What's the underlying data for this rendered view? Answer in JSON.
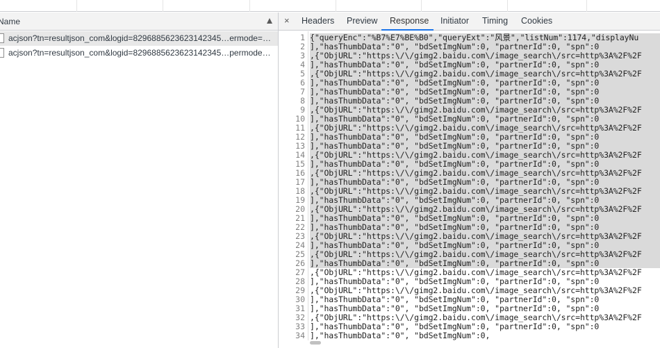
{
  "left": {
    "column_header": "Name",
    "requests": [
      "acjson?tn=resultjson_com&logid=8296885623623142345…ermode=…",
      "acjson?tn=resultjson_com&logid=8296885623623142345…permode…"
    ]
  },
  "tabs": {
    "close_symbol": "×",
    "items": [
      "Headers",
      "Preview",
      "Response",
      "Initiator",
      "Timing",
      "Cookies"
    ],
    "active": "Response"
  },
  "response": {
    "lines": [
      "{\"queryEnc\":\"%B7%E7%BE%B0\",\"queryExt\":\"风景\",\"listNum\":1174,\"displayNu",
      "],\"hasThumbData\":\"0\",    \"bdSetImgNum\":0,    \"partnerId\":0,    \"spn\":0",
      ",{\"ObjURL\":\"https:\\/\\/gimg2.baidu.com\\/image_search\\/src=http%3A%2F%2F",
      "],\"hasThumbData\":\"0\",    \"bdSetImgNum\":0,    \"partnerId\":0,    \"spn\":0",
      ",{\"ObjURL\":\"https:\\/\\/gimg2.baidu.com\\/image_search\\/src=http%3A%2F%2F",
      "],\"hasThumbData\":\"0\",    \"bdSetImgNum\":0,    \"partnerId\":0,    \"spn\":0",
      "],\"hasThumbData\":\"0\",    \"bdSetImgNum\":0,    \"partnerId\":0,    \"spn\":0",
      "],\"hasThumbData\":\"0\",    \"bdSetImgNum\":0,    \"partnerId\":0,    \"spn\":0",
      ",{\"ObjURL\":\"https:\\/\\/gimg2.baidu.com\\/image_search\\/src=http%3A%2F%2F",
      "],\"hasThumbData\":\"0\",    \"bdSetImgNum\":0,    \"partnerId\":0,    \"spn\":0",
      ",{\"ObjURL\":\"https:\\/\\/gimg2.baidu.com\\/image_search\\/src=http%3A%2F%2F",
      "],\"hasThumbData\":\"0\",    \"bdSetImgNum\":0,    \"partnerId\":0,    \"spn\":0",
      "],\"hasThumbData\":\"0\",    \"bdSetImgNum\":0,    \"partnerId\":0,    \"spn\":0",
      ",{\"ObjURL\":\"https:\\/\\/gimg2.baidu.com\\/image_search\\/src=http%3A%2F%2F",
      "],\"hasThumbData\":\"0\",    \"bdSetImgNum\":0,    \"partnerId\":0,    \"spn\":0",
      ",{\"ObjURL\":\"https:\\/\\/gimg2.baidu.com\\/image_search\\/src=http%3A%2F%2F",
      "],\"hasThumbData\":\"0\",    \"bdSetImgNum\":0,    \"partnerId\":0,    \"spn\":0",
      ",{\"ObjURL\":\"https:\\/\\/gimg2.baidu.com\\/image_search\\/src=http%3A%2F%2F",
      "],\"hasThumbData\":\"0\",    \"bdSetImgNum\":0,    \"partnerId\":0,    \"spn\":0",
      ",{\"ObjURL\":\"https:\\/\\/gimg2.baidu.com\\/image_search\\/src=http%3A%2F%2F",
      "],\"hasThumbData\":\"0\",    \"bdSetImgNum\":0,    \"partnerId\":0,    \"spn\":0",
      "],\"hasThumbData\":\"0\",    \"bdSetImgNum\":0,    \"partnerId\":0,    \"spn\":0",
      ",{\"ObjURL\":\"https:\\/\\/gimg2.baidu.com\\/image_search\\/src=http%3A%2F%2F",
      "],\"hasThumbData\":\"0\",    \"bdSetImgNum\":0,    \"partnerId\":0,    \"spn\":0",
      ",{\"ObjURL\":\"https:\\/\\/gimg2.baidu.com\\/image_search\\/src=http%3A%2F%2F",
      "],\"hasThumbData\":\"0\",    \"bdSetImgNum\":0,    \"partnerId\":0,    \"spn\":0",
      ",{\"ObjURL\":\"https:\\/\\/gimg2.baidu.com\\/image_search\\/src=http%3A%2F%2F",
      "],\"hasThumbData\":\"0\",    \"bdSetImgNum\":0,    \"partnerId\":0,    \"spn\":0",
      ",{\"ObjURL\":\"https:\\/\\/gimg2.baidu.com\\/image_search\\/src=http%3A%2F%2F",
      "],\"hasThumbData\":\"0\",    \"bdSetImgNum\":0,    \"partnerId\":0,    \"spn\":0",
      "],\"hasThumbData\":\"0\",    \"bdSetImgNum\":0,    \"partnerId\":0,    \"spn\":0",
      ",{\"ObjURL\":\"https:\\/\\/gimg2.baidu.com\\/image_search\\/src=http%3A%2F%2F",
      "],\"hasThumbData\":\"0\",    \"bdSetImgNum\":0,    \"partnerId\":0,    \"spn\":0",
      "],\"hasThumbData\":\"0\",    \"bdSetImgNum\":0,",
      ""
    ]
  },
  "colors": {
    "panel_bg": "#f3f3f3",
    "border": "#cbcdd1",
    "selected_row": "#e8e8e8",
    "active_tab_underline": "#1a73e8",
    "text_selection": "#dadada"
  }
}
